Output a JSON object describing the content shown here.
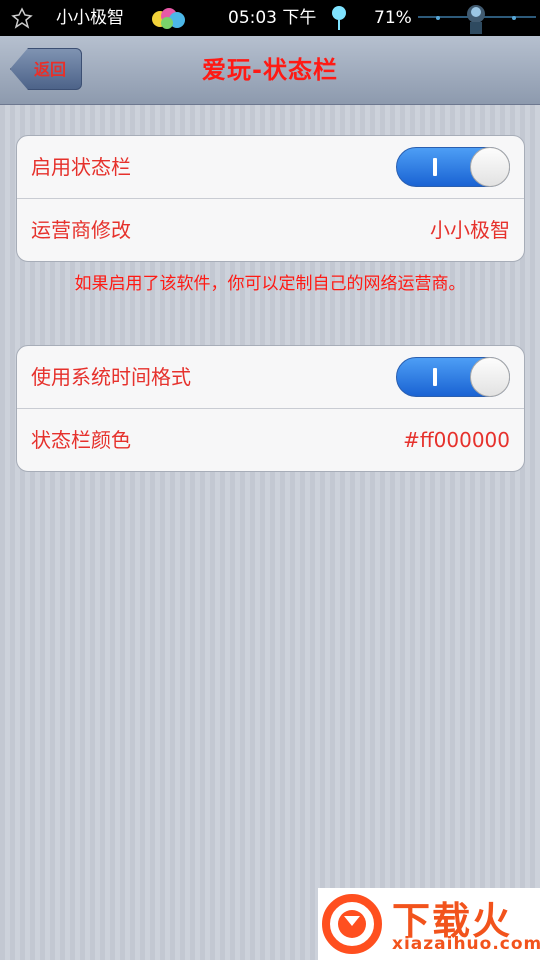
{
  "status_bar": {
    "carrier": "小小极智",
    "time": "05:03 下午",
    "battery": "71%"
  },
  "nav": {
    "back_label": "返回",
    "title": "爱玩-状态栏"
  },
  "group1": {
    "rows": [
      {
        "label": "启用状态栏",
        "toggle_on": true
      },
      {
        "label": "运营商修改",
        "value": "小小极智"
      }
    ]
  },
  "note": "如果启用了该软件，你可以定制自己的网络运营商。",
  "group2": {
    "rows": [
      {
        "label": "使用系统时间格式",
        "toggle_on": true
      },
      {
        "label": "状态栏颜色",
        "value": "#ff000000"
      }
    ]
  },
  "watermark": {
    "brand": "下载火",
    "domain": "xiazaihuo.com"
  },
  "colors": {
    "accent_text": "#e6312c",
    "toggle_on": "#1a63d3"
  }
}
